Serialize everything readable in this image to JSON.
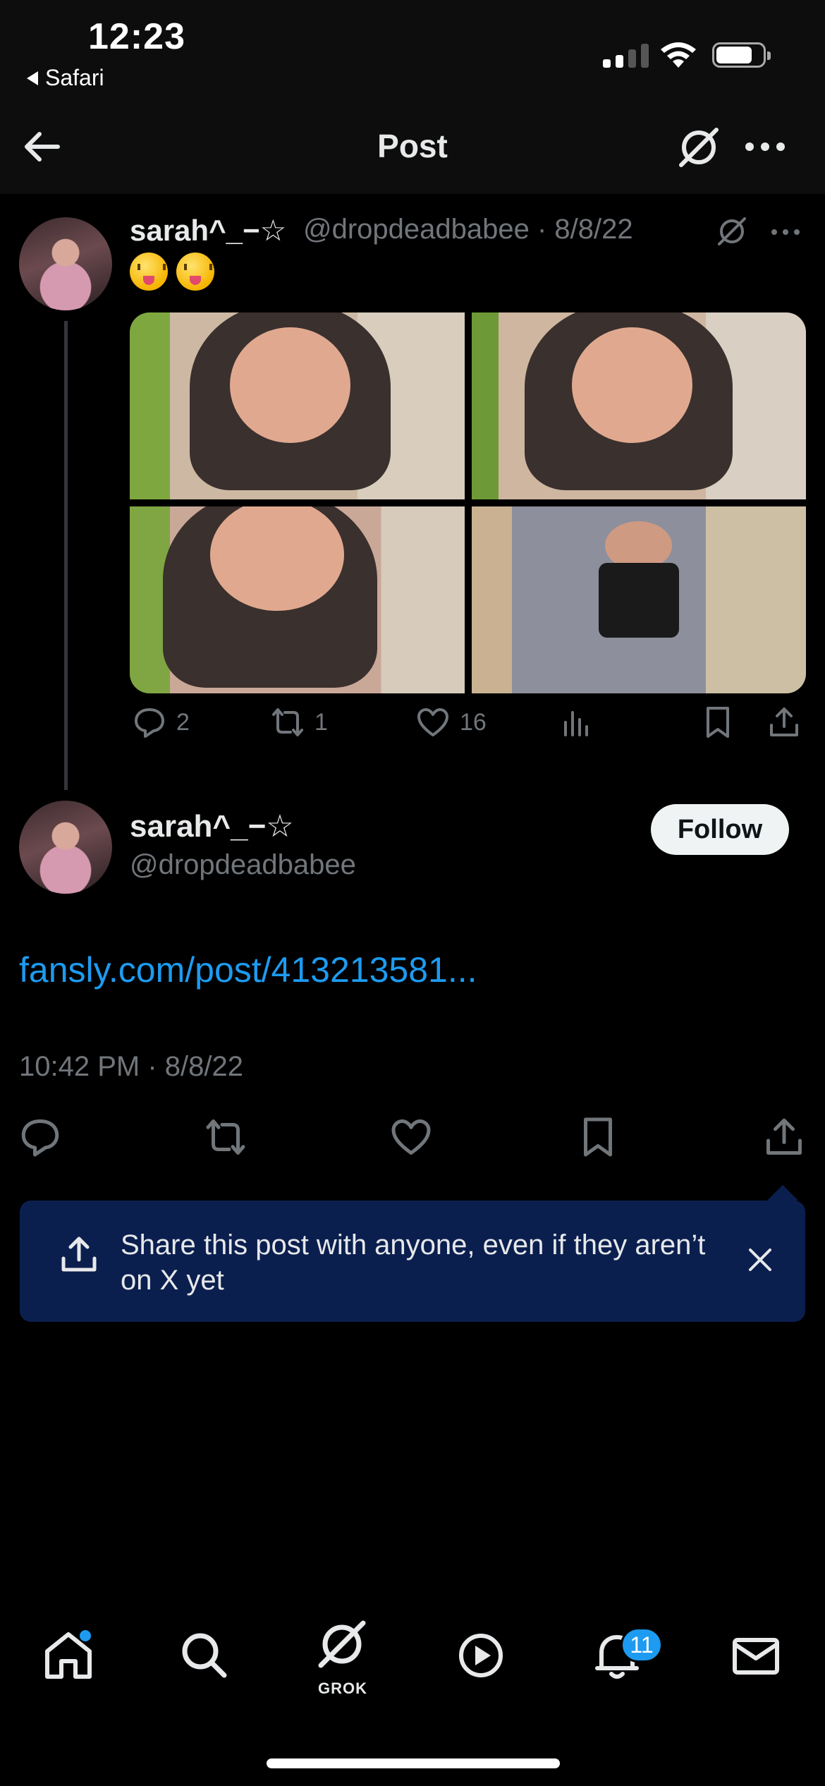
{
  "status_bar": {
    "time": "12:23",
    "back_app": "Safari"
  },
  "header": {
    "title": "Post"
  },
  "parent_post": {
    "display_name": "sarah^_−☆",
    "meta": "@dropdeadbabee · 8/8/22",
    "emoji_count": 2,
    "emoji_name": "squinting-face-with-tongue",
    "media_count": 4,
    "stats": {
      "replies": "2",
      "reposts": "1",
      "likes": "16"
    }
  },
  "focused_post": {
    "display_name": "sarah^_−☆",
    "handle": "@dropdeadbabee",
    "follow_label": "Follow",
    "link_text": "fansly.com/post/413213581...",
    "timestamp": "10:42 PM · 8/8/22"
  },
  "tooltip": {
    "text": "Share this post with anyone, even if they aren’t on X yet"
  },
  "bottom_nav": {
    "grok_label": "GROK",
    "notifications_badge": "11",
    "items": [
      "home-icon",
      "search-icon",
      "grok-icon",
      "video-icon",
      "notifications-icon",
      "messages-icon"
    ]
  },
  "colors": {
    "background": "#000000",
    "accent": "#1d9bf0",
    "muted_text": "#71767b",
    "tooltip_bg": "#0b1f4f"
  }
}
